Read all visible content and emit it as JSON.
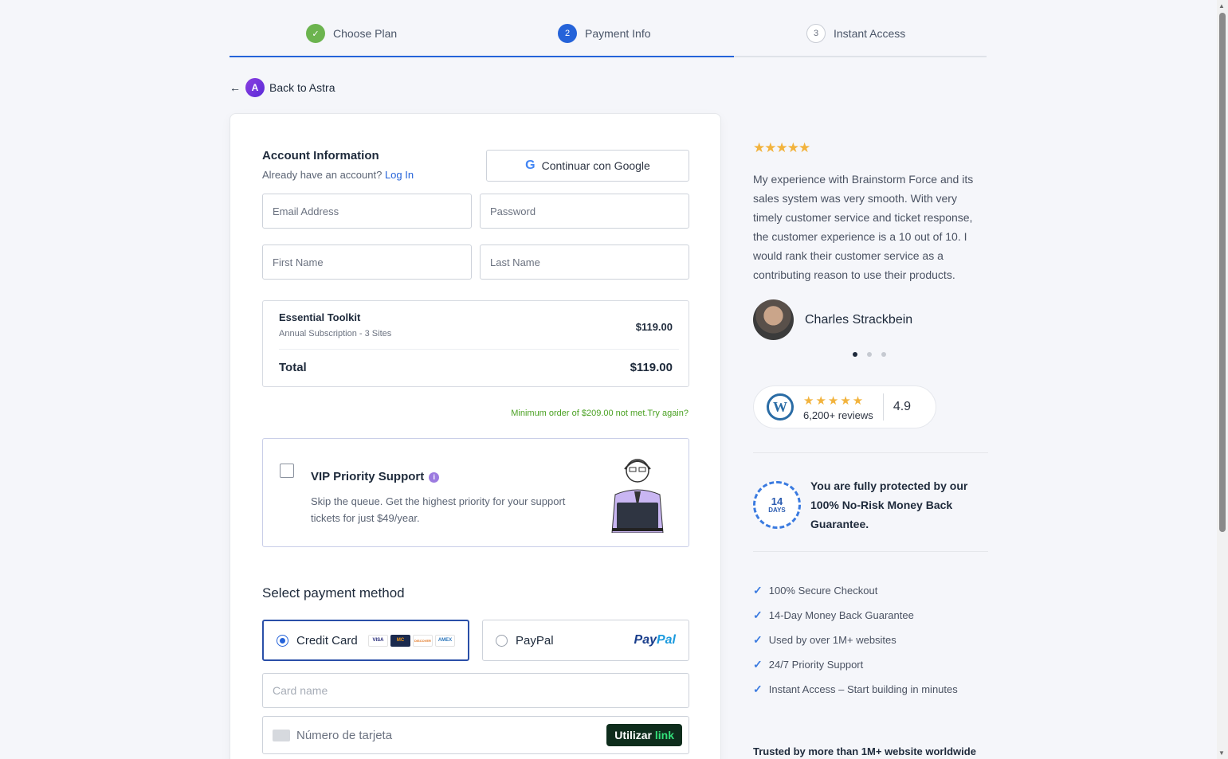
{
  "steps": [
    {
      "label": "Choose Plan",
      "mark": "✓"
    },
    {
      "label": "Payment Info",
      "mark": "2"
    },
    {
      "label": "Instant Access",
      "mark": "3"
    }
  ],
  "back_label": "Back to Astra",
  "account": {
    "title": "Account Information",
    "have_account": "Already have an account?",
    "login_link": "Log In",
    "google_button": "Continuar con Google",
    "email_placeholder": "Email Address",
    "password_placeholder": "Password",
    "first_name_placeholder": "First Name",
    "last_name_placeholder": "Last Name"
  },
  "order": {
    "product_name": "Essential Toolkit",
    "product_sub": "Annual Subscription - 3 Sites",
    "product_price": "$119.00",
    "total_label": "Total",
    "total_price": "$119.00"
  },
  "min_order_message": "Minimum order of $209.00 not met.Try again?",
  "vip": {
    "title": "VIP Priority Support",
    "description": "Skip the queue. Get the highest priority for your support tickets for just $49/year.",
    "checked": false
  },
  "payment": {
    "title": "Select payment method",
    "credit_card_label": "Credit Card",
    "card_brands": [
      "VISA",
      "MC",
      "DISCOVER",
      "AMEX"
    ],
    "paypal_label": "PayPal",
    "paypal_logo_a": "Pay",
    "paypal_logo_b": "Pal",
    "selected": "credit_card",
    "card_name_placeholder": "Card name",
    "card_number_placeholder": "Número de tarjeta",
    "link_button_a": "Utilizar",
    "link_button_b": "link"
  },
  "testimonial": {
    "stars": "★★★★★",
    "quote": "My experience with Brainstorm Force and its sales system was very smooth. With very timely customer service and ticket response, the customer experience is a 10 out of 10. I would rank their customer service as a contributing reason to use their products.",
    "author": "Charles Strackbein",
    "active_dot": 1,
    "dot_count": 3
  },
  "rating": {
    "stars": "★★★★★",
    "reviews": "6,200+ reviews",
    "score": "4.9"
  },
  "guarantee": {
    "seal_number": "14",
    "seal_unit": "DAYS",
    "text": "You are fully protected by our 100% No-Risk Money Back Guarantee."
  },
  "benefits": [
    "100% Secure Checkout",
    "14-Day Money Back Guarantee",
    "Used by over 1M+ websites",
    "24/7 Priority Support",
    "Instant Access – Start building in minutes"
  ],
  "trusted_text": "Trusted by more than 1M+ website worldwide",
  "colors": {
    "accent": "#2563d9",
    "done": "#6cb44f",
    "star": "#f2b33d",
    "success_text": "#4aa122"
  }
}
